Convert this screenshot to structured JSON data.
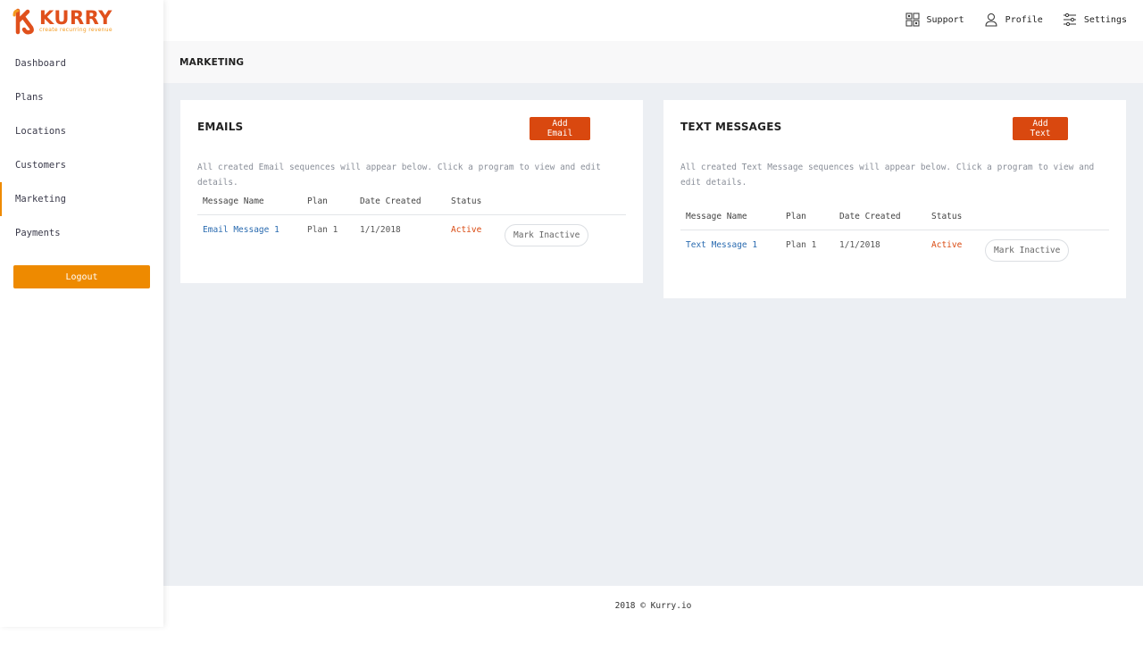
{
  "brand": {
    "name": "KURRY",
    "tagline": "create recurring revenue",
    "color": "#e0501c",
    "accent": "#ee8a00"
  },
  "sidebar": {
    "items": [
      {
        "label": "Dashboard"
      },
      {
        "label": "Plans"
      },
      {
        "label": "Locations"
      },
      {
        "label": "Customers"
      },
      {
        "label": "Marketing",
        "active": true
      },
      {
        "label": "Payments"
      }
    ],
    "logout_label": "Logout"
  },
  "topbar": {
    "support": {
      "label": "Support",
      "icon": "support-icon"
    },
    "profile": {
      "label": "Profile",
      "icon": "profile-icon"
    },
    "settings": {
      "label": "Settings",
      "icon": "settings-icon"
    }
  },
  "page": {
    "title": "MARKETING"
  },
  "emails": {
    "title": "EMAILS",
    "button": "Add Email",
    "description": "All created Email sequences will appear below. Click a program to view and edit details.",
    "columns": [
      "Message Name",
      "Plan",
      "Date Created",
      "Status"
    ],
    "rows": [
      {
        "name": "Email Message 1",
        "plan": "Plan 1",
        "date": "1/1/2018",
        "status": "Active",
        "action": "Mark Inactive"
      }
    ]
  },
  "texts": {
    "title": "TEXT MESSAGES",
    "button": "Add Text",
    "description": "All created Text Message sequences will appear below. Click a program to view and edit details.",
    "columns": [
      "Message Name",
      "Plan",
      "Date Created",
      "Status"
    ],
    "rows": [
      {
        "name": "Text Message 1",
        "plan": "Plan 1",
        "date": "1/1/2018",
        "status": "Active",
        "action": "Mark Inactive"
      }
    ]
  },
  "footer": {
    "text": "2018 © Kurry.io"
  }
}
